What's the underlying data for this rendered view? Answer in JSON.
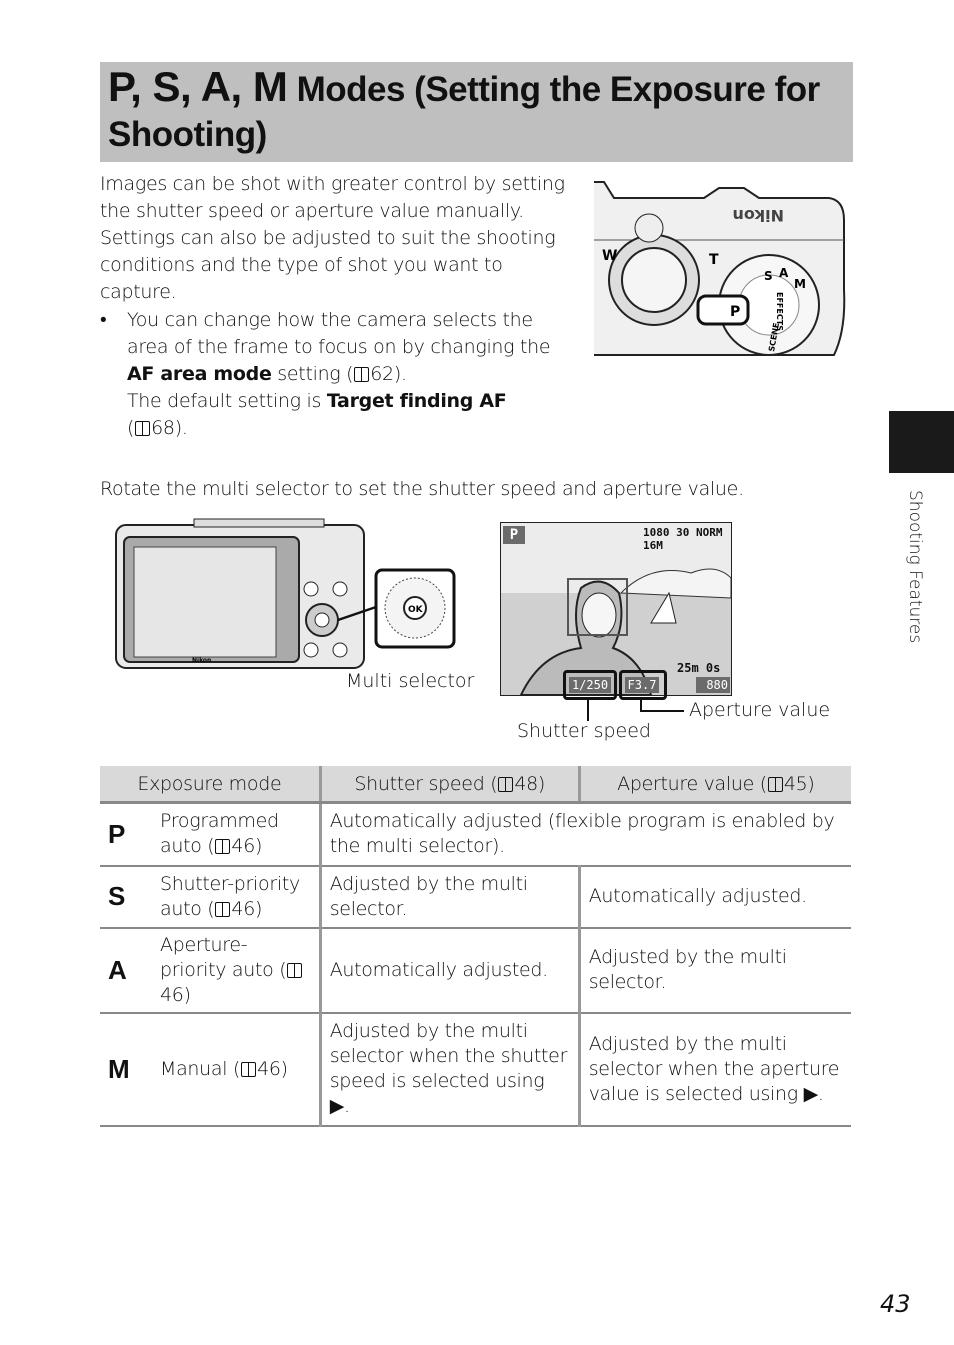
{
  "header": {
    "mode_letters": "P, S, A, M",
    "title_rest": " Modes (Setting the Exposure for Shooting)"
  },
  "intro": "Images can be shot with greater control by setting the shutter speed or aperture value manually. Settings can also be adjusted to suit the shooting conditions and the type of shot you want to capture.",
  "bullet": {
    "marker": "•",
    "part1": "You can change how the camera selects the area of the frame to focus on by changing the ",
    "af_area_mode": "AF area mode",
    "part2": " setting (",
    "ref1": "62",
    "part3": ").",
    "default_prefix": "The default setting is ",
    "target_finding": "Target finding AF",
    "ref2_open": "(",
    "ref2": "68",
    "ref2_close": ")."
  },
  "rotate_text": "Rotate the multi selector to set the shutter speed and aperture value.",
  "camera_top": {
    "brand": "Nikon",
    "dial_labels": [
      "P",
      "S",
      "A",
      "M",
      "EFFECTS",
      "SCENE"
    ],
    "zoom_w": "W",
    "zoom_t": "T"
  },
  "camera_back": {
    "brand": "Nikon",
    "ok": "OK"
  },
  "lcd": {
    "mode": "P",
    "movie": "1080",
    "fps": "30",
    "quality": "NORM",
    "size": "16M",
    "time_remaining": "25m 0s",
    "shutter": "1/250",
    "aperture": "F3.7",
    "shots": "880"
  },
  "captions": {
    "multi_selector": "Multi selector",
    "shutter_speed": "Shutter speed",
    "aperture_value": "Aperture value"
  },
  "table": {
    "headers": [
      "Exposure mode",
      "Shutter speed (",
      "48)",
      "Aperture value (",
      "45)"
    ],
    "rows": [
      {
        "letter": "P",
        "mode": "Programmed auto (",
        "ref": "46)",
        "merged": "Automatically adjusted (flexible program is enabled by the multi selector)."
      },
      {
        "letter": "S",
        "mode": "Shutter-priority auto (",
        "ref": "46)",
        "shutter": "Adjusted by the multi selector.",
        "aperture": "Automatically adjusted."
      },
      {
        "letter": "A",
        "mode": "Aperture-priority auto (",
        "ref": "46)",
        "shutter": "Automatically adjusted.",
        "aperture": "Adjusted by the multi selector."
      },
      {
        "letter": "M",
        "mode": "Manual (",
        "ref": "46)",
        "shutter": "Adjusted by the multi selector when the shutter speed is selected using ▶.",
        "aperture": "Adjusted by the multi selector when the aperture value is selected using ▶."
      }
    ]
  },
  "side_tab": "Shooting Features",
  "page_number": "43"
}
